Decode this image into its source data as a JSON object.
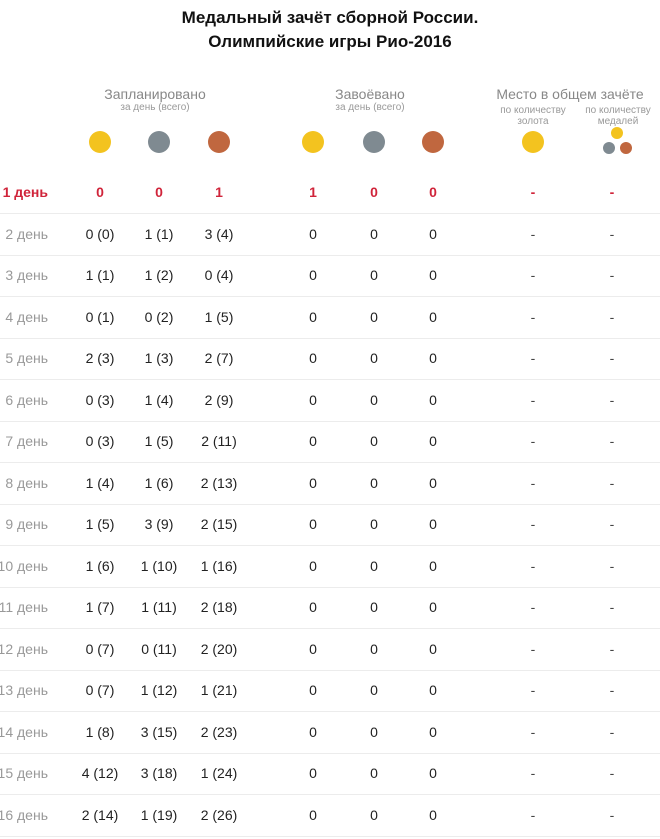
{
  "title_line1": "Медальный зачёт сборной России.",
  "title_line2": "Олимпийские игры Рио-2016",
  "groups": {
    "planned": {
      "label": "Запланировано",
      "sublabel": "за день (всего)"
    },
    "won": {
      "label": "Завоёвано",
      "sublabel": "за день (всего)"
    },
    "place": {
      "label": "Место в общем зачёте",
      "by_gold": "по количеству золота",
      "by_medals": "по количеству медалей"
    }
  },
  "colors": {
    "gold": "#f3c31f",
    "silver": "#7f8a91",
    "bronze": "#c0673f",
    "highlight": "#d0243a"
  },
  "rows": [
    {
      "day": "1 день",
      "p_gold": "0",
      "p_silver": "0",
      "p_bronze": "1",
      "w_gold": "1",
      "w_silver": "0",
      "w_bronze": "0",
      "place_gold": "-",
      "place_total": "-"
    },
    {
      "day": "2 день",
      "p_gold": "0 (0)",
      "p_silver": "1 (1)",
      "p_bronze": "3 (4)",
      "w_gold": "0",
      "w_silver": "0",
      "w_bronze": "0",
      "place_gold": "-",
      "place_total": "-"
    },
    {
      "day": "3 день",
      "p_gold": "1 (1)",
      "p_silver": "1 (2)",
      "p_bronze": "0 (4)",
      "w_gold": "0",
      "w_silver": "0",
      "w_bronze": "0",
      "place_gold": "-",
      "place_total": "-"
    },
    {
      "day": "4 день",
      "p_gold": "0 (1)",
      "p_silver": "0 (2)",
      "p_bronze": "1 (5)",
      "w_gold": "0",
      "w_silver": "0",
      "w_bronze": "0",
      "place_gold": "-",
      "place_total": "-"
    },
    {
      "day": "5 день",
      "p_gold": "2 (3)",
      "p_silver": "1 (3)",
      "p_bronze": "2 (7)",
      "w_gold": "0",
      "w_silver": "0",
      "w_bronze": "0",
      "place_gold": "-",
      "place_total": "-"
    },
    {
      "day": "6 день",
      "p_gold": "0 (3)",
      "p_silver": "1 (4)",
      "p_bronze": "2 (9)",
      "w_gold": "0",
      "w_silver": "0",
      "w_bronze": "0",
      "place_gold": "-",
      "place_total": "-"
    },
    {
      "day": "7 день",
      "p_gold": "0 (3)",
      "p_silver": "1 (5)",
      "p_bronze": "2 (11)",
      "w_gold": "0",
      "w_silver": "0",
      "w_bronze": "0",
      "place_gold": "-",
      "place_total": "-"
    },
    {
      "day": "8 день",
      "p_gold": "1 (4)",
      "p_silver": "1 (6)",
      "p_bronze": "2 (13)",
      "w_gold": "0",
      "w_silver": "0",
      "w_bronze": "0",
      "place_gold": "-",
      "place_total": "-"
    },
    {
      "day": "9 день",
      "p_gold": "1 (5)",
      "p_silver": "3 (9)",
      "p_bronze": "2 (15)",
      "w_gold": "0",
      "w_silver": "0",
      "w_bronze": "0",
      "place_gold": "-",
      "place_total": "-"
    },
    {
      "day": "10 день",
      "p_gold": "1 (6)",
      "p_silver": "1 (10)",
      "p_bronze": "1 (16)",
      "w_gold": "0",
      "w_silver": "0",
      "w_bronze": "0",
      "place_gold": "-",
      "place_total": "-"
    },
    {
      "day": "11 день",
      "p_gold": "1 (7)",
      "p_silver": "1 (11)",
      "p_bronze": "2 (18)",
      "w_gold": "0",
      "w_silver": "0",
      "w_bronze": "0",
      "place_gold": "-",
      "place_total": "-"
    },
    {
      "day": "12 день",
      "p_gold": "0 (7)",
      "p_silver": "0 (11)",
      "p_bronze": "2 (20)",
      "w_gold": "0",
      "w_silver": "0",
      "w_bronze": "0",
      "place_gold": "-",
      "place_total": "-"
    },
    {
      "day": "13 день",
      "p_gold": "0 (7)",
      "p_silver": "1 (12)",
      "p_bronze": "1 (21)",
      "w_gold": "0",
      "w_silver": "0",
      "w_bronze": "0",
      "place_gold": "-",
      "place_total": "-"
    },
    {
      "day": "14 день",
      "p_gold": "1 (8)",
      "p_silver": "3 (15)",
      "p_bronze": "2 (23)",
      "w_gold": "0",
      "w_silver": "0",
      "w_bronze": "0",
      "place_gold": "-",
      "place_total": "-"
    },
    {
      "day": "15 день",
      "p_gold": "4 (12)",
      "p_silver": "3 (18)",
      "p_bronze": "1 (24)",
      "w_gold": "0",
      "w_silver": "0",
      "w_bronze": "0",
      "place_gold": "-",
      "place_total": "-"
    },
    {
      "day": "16 день",
      "p_gold": "2 (14)",
      "p_silver": "1 (19)",
      "p_bronze": "2 (26)",
      "w_gold": "0",
      "w_silver": "0",
      "w_bronze": "0",
      "place_gold": "-",
      "place_total": "-"
    }
  ]
}
